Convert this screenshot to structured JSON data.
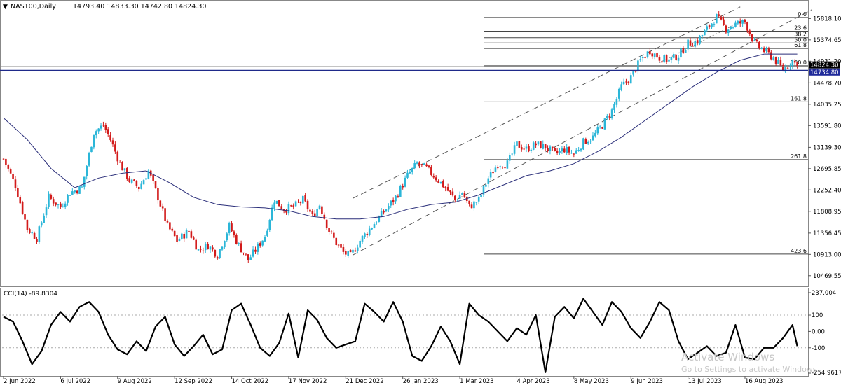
{
  "header": {
    "symbol": "NAS100,Daily",
    "ohlc": "14793.40 14833.30 14742.80 14824.30"
  },
  "indicator": {
    "label": "CCI(14) -89.8304",
    "axis_max": "237.004",
    "axis_min": "-254.9617"
  },
  "fibonacci": {
    "levels": [
      {
        "label": "0.0",
        "price": 15840
      },
      {
        "label": "23.6",
        "price": 15555
      },
      {
        "label": "38.2",
        "price": 15420
      },
      {
        "label": "50.0",
        "price": 15310
      },
      {
        "label": "61.8",
        "price": 15195
      },
      {
        "label": "100.0",
        "price": 14835
      },
      {
        "label": "161.8",
        "price": 14085
      },
      {
        "label": "261.8",
        "price": 12885
      },
      {
        "label": "423.6",
        "price": 10920
      }
    ]
  },
  "price_tags": {
    "current": "14824.30",
    "line": "14734.80"
  },
  "colors": {
    "bull": "#2bb6d8",
    "bear": "#d21a1a",
    "ma": "#2b2f7a",
    "hline": "#1f2a8a",
    "grid": "#999999"
  },
  "watermark": {
    "title": "Activate Windows",
    "subtitle": "Go to Settings to activate Windows."
  },
  "chart_data": [
    {
      "type": "candlestick",
      "title": "NAS100,Daily",
      "y_ticks": [
        "15818.10",
        "15374.65",
        "14931.20",
        "14478.70",
        "14035.25",
        "13591.80",
        "13139.30",
        "12695.85",
        "12252.40",
        "11808.95",
        "11356.45",
        "10913.00",
        "10469.55"
      ],
      "x_ticks": [
        "2 Jun 2022",
        "6 Jul 2022",
        "9 Aug 2022",
        "12 Sep 2022",
        "14 Oct 2022",
        "17 Nov 2022",
        "21 Dec 2022",
        "26 Jan 2023",
        "1 Mar 2023",
        "4 Apr 2023",
        "8 May 2023",
        "9 Jun 2023",
        "13 Jul 2023",
        "16 Aug 2023"
      ],
      "ylim": [
        10350,
        15940
      ],
      "grid": false,
      "legend": "none",
      "close_path": [
        [
          0,
          12900
        ],
        [
          5,
          12350
        ],
        [
          10,
          11450
        ],
        [
          14,
          11250
        ],
        [
          19,
          12100
        ],
        [
          24,
          11900
        ],
        [
          28,
          12200
        ],
        [
          33,
          12300
        ],
        [
          38,
          13450
        ],
        [
          42,
          13600
        ],
        [
          45,
          13300
        ],
        [
          49,
          12800
        ],
        [
          53,
          12450
        ],
        [
          57,
          12300
        ],
        [
          61,
          12650
        ],
        [
          65,
          12100
        ],
        [
          69,
          11500
        ],
        [
          73,
          11200
        ],
        [
          78,
          11400
        ],
        [
          82,
          11000
        ],
        [
          86,
          11100
        ],
        [
          90,
          10900
        ],
        [
          95,
          11500
        ],
        [
          99,
          11100
        ],
        [
          103,
          10800
        ],
        [
          106,
          11000
        ],
        [
          110,
          11300
        ],
        [
          114,
          12050
        ],
        [
          118,
          11850
        ],
        [
          122,
          11900
        ],
        [
          126,
          12050
        ],
        [
          130,
          11700
        ],
        [
          133,
          11950
        ],
        [
          137,
          11400
        ],
        [
          140,
          11150
        ],
        [
          143,
          10950
        ],
        [
          146,
          10880
        ],
        [
          150,
          11200
        ],
        [
          155,
          11500
        ],
        [
          160,
          11800
        ],
        [
          165,
          12100
        ],
        [
          170,
          12550
        ],
        [
          174,
          12800
        ],
        [
          178,
          12700
        ],
        [
          182,
          12500
        ],
        [
          186,
          12300
        ],
        [
          190,
          12050
        ],
        [
          193,
          12200
        ],
        [
          196,
          11900
        ],
        [
          200,
          12050
        ],
        [
          204,
          12500
        ],
        [
          208,
          12800
        ],
        [
          212,
          12800
        ],
        [
          216,
          13200
        ],
        [
          220,
          13100
        ],
        [
          224,
          13200
        ],
        [
          228,
          13150
        ],
        [
          232,
          13000
        ],
        [
          236,
          13100
        ],
        [
          240,
          13000
        ],
        [
          244,
          13250
        ],
        [
          248,
          13350
        ],
        [
          252,
          13600
        ],
        [
          256,
          13900
        ],
        [
          260,
          14400
        ],
        [
          264,
          14600
        ],
        [
          268,
          14950
        ],
        [
          272,
          15150
        ],
        [
          276,
          15000
        ],
        [
          280,
          14950
        ],
        [
          284,
          15050
        ],
        [
          288,
          15300
        ],
        [
          292,
          15350
        ],
        [
          296,
          15600
        ],
        [
          300,
          15850
        ],
        [
          304,
          15600
        ],
        [
          308,
          15700
        ],
        [
          312,
          15750
        ],
        [
          316,
          15300
        ],
        [
          320,
          15150
        ],
        [
          324,
          15000
        ],
        [
          328,
          14750
        ],
        [
          332,
          14950
        ],
        [
          334,
          14824
        ]
      ],
      "ma_path": [
        [
          0,
          13750
        ],
        [
          10,
          13300
        ],
        [
          20,
          12700
        ],
        [
          30,
          12300
        ],
        [
          40,
          12500
        ],
        [
          50,
          12600
        ],
        [
          60,
          12650
        ],
        [
          70,
          12400
        ],
        [
          80,
          12100
        ],
        [
          90,
          11950
        ],
        [
          100,
          11900
        ],
        [
          110,
          11880
        ],
        [
          120,
          11820
        ],
        [
          130,
          11700
        ],
        [
          140,
          11650
        ],
        [
          150,
          11650
        ],
        [
          160,
          11700
        ],
        [
          170,
          11850
        ],
        [
          180,
          11950
        ],
        [
          190,
          12000
        ],
        [
          200,
          12150
        ],
        [
          210,
          12350
        ],
        [
          220,
          12550
        ],
        [
          230,
          12650
        ],
        [
          240,
          12800
        ],
        [
          250,
          13050
        ],
        [
          260,
          13350
        ],
        [
          270,
          13700
        ],
        [
          280,
          14050
        ],
        [
          290,
          14400
        ],
        [
          300,
          14700
        ],
        [
          310,
          14950
        ],
        [
          320,
          15080
        ],
        [
          334,
          15080
        ]
      ]
    },
    {
      "type": "line",
      "title": "CCI(14) -89.8304",
      "y_ticks": [
        "237.004",
        "100",
        "0.00",
        "-100",
        "-254.9617"
      ],
      "ylim": [
        -254.9617,
        237.004
      ],
      "grid": false,
      "path": [
        [
          0,
          90
        ],
        [
          4,
          60
        ],
        [
          8,
          -60
        ],
        [
          12,
          -200
        ],
        [
          16,
          -120
        ],
        [
          20,
          40
        ],
        [
          24,
          120
        ],
        [
          28,
          60
        ],
        [
          32,
          150
        ],
        [
          36,
          180
        ],
        [
          40,
          120
        ],
        [
          44,
          -20
        ],
        [
          48,
          -110
        ],
        [
          52,
          -140
        ],
        [
          56,
          -60
        ],
        [
          60,
          -120
        ],
        [
          64,
          30
        ],
        [
          68,
          90
        ],
        [
          72,
          -80
        ],
        [
          76,
          -150
        ],
        [
          80,
          -90
        ],
        [
          84,
          -20
        ],
        [
          88,
          -140
        ],
        [
          92,
          -110
        ],
        [
          96,
          130
        ],
        [
          100,
          170
        ],
        [
          104,
          40
        ],
        [
          108,
          -100
        ],
        [
          112,
          -150
        ],
        [
          116,
          -70
        ],
        [
          120,
          110
        ],
        [
          124,
          -160
        ],
        [
          128,
          130
        ],
        [
          132,
          70
        ],
        [
          136,
          -40
        ],
        [
          140,
          -100
        ],
        [
          144,
          -80
        ],
        [
          148,
          -60
        ],
        [
          152,
          170
        ],
        [
          156,
          120
        ],
        [
          160,
          60
        ],
        [
          164,
          180
        ],
        [
          168,
          60
        ],
        [
          172,
          -150
        ],
        [
          176,
          -180
        ],
        [
          180,
          -90
        ],
        [
          184,
          30
        ],
        [
          188,
          -60
        ],
        [
          192,
          -200
        ],
        [
          196,
          170
        ],
        [
          200,
          100
        ],
        [
          204,
          60
        ],
        [
          208,
          0
        ],
        [
          212,
          -60
        ],
        [
          216,
          20
        ],
        [
          220,
          -20
        ],
        [
          224,
          100
        ],
        [
          228,
          -250
        ],
        [
          232,
          90
        ],
        [
          236,
          150
        ],
        [
          240,
          80
        ],
        [
          244,
          200
        ],
        [
          248,
          120
        ],
        [
          252,
          40
        ],
        [
          256,
          180
        ],
        [
          260,
          120
        ],
        [
          264,
          20
        ],
        [
          268,
          -40
        ],
        [
          272,
          60
        ],
        [
          276,
          180
        ],
        [
          280,
          130
        ],
        [
          284,
          -60
        ],
        [
          288,
          -170
        ],
        [
          292,
          -130
        ],
        [
          296,
          -90
        ],
        [
          300,
          -150
        ],
        [
          304,
          -130
        ],
        [
          308,
          40
        ],
        [
          312,
          -160
        ],
        [
          316,
          -170
        ],
        [
          320,
          -100
        ],
        [
          324,
          -100
        ],
        [
          328,
          -40
        ],
        [
          332,
          40
        ],
        [
          334,
          -89.83
        ]
      ]
    }
  ]
}
